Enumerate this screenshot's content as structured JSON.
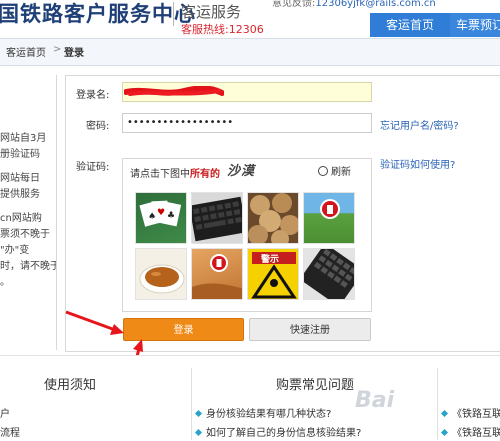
{
  "header": {
    "logo_text": "国铁路客户服务中心",
    "service_name": "客运服务",
    "hotline": "客服热线:12306",
    "top_info_label": "意见反馈:",
    "top_info_email": "12306yjfk@rails.com.cn"
  },
  "nav": {
    "home": "客运首页",
    "trains": "车票预订"
  },
  "breadcrumb": {
    "home": "客运首页",
    "separator": ">",
    "current": "登录"
  },
  "left_notice": {
    "lines": [
      "网站自3月",
      "册验证码",
      "",
      "网站每日",
      "提供服务",
      "",
      "cn网站购",
      "票须不晚于",
      "\"办\"变",
      "时，请不晚于",
      "。"
    ]
  },
  "login": {
    "username_label": "登录名:",
    "username_value": "",
    "password_label": "密码:",
    "password_value": "••••••••••••••••••",
    "forgot_link": "忘记用户名/密码?",
    "captcha_label": "验证码:",
    "captcha_help_link": "验证码如何使用?",
    "captcha_instruction_pre": "请点击下图中",
    "captcha_instruction_strong": "所有的",
    "captcha_keyword": "沙漠",
    "refresh_label": "刷新",
    "tiles": [
      "playing-cards",
      "keyboard",
      "walnuts",
      "railway-logo-grass",
      "tea-cup",
      "railway-logo-desert",
      "warning-sign",
      "keyboard"
    ],
    "login_button": "登录",
    "register_button": "快速注册"
  },
  "bottom": {
    "col1_title": "使用须知",
    "col1_items": [
      "户",
      "流程"
    ],
    "col2_title": "购票常见问题",
    "col2_items": [
      "身份核验结果有哪几种状态?",
      "如何了解自己的身份信息核验结果?"
    ],
    "col3_items": [
      "《铁路互联",
      "《铁路互联"
    ],
    "watermark": "Bai"
  },
  "colors": {
    "nav_blue": "#2f7dd6",
    "login_orange": "#f08a16",
    "link_blue": "#2a63b8",
    "hotline_red": "#d9262c"
  }
}
